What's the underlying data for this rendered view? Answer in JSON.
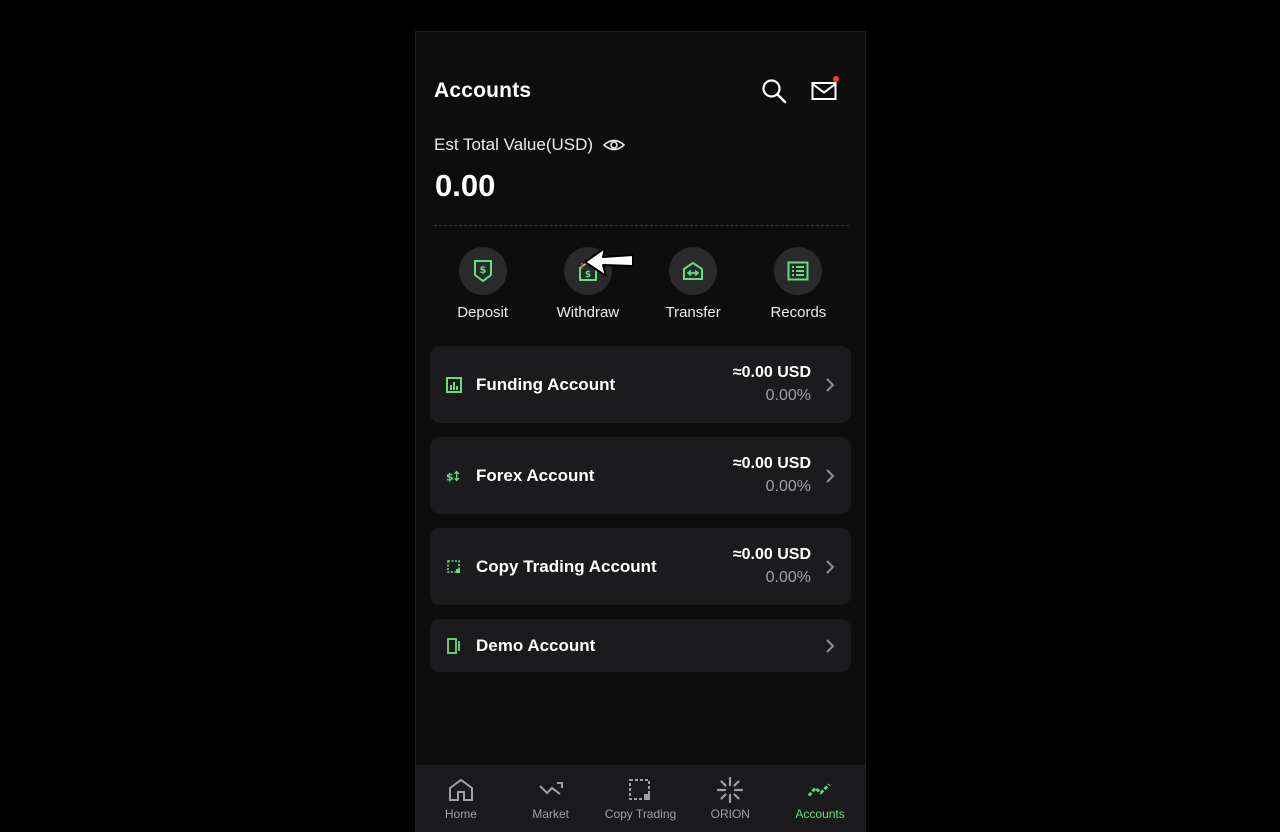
{
  "header": {
    "title": "Accounts",
    "search_icon": "search-icon",
    "mail_icon": "mail-icon",
    "has_notification": true
  },
  "summary": {
    "est_label": "Est Total Value(USD)",
    "eye_icon": "eye-icon",
    "total_value": "0.00"
  },
  "actions": [
    {
      "label": "Deposit",
      "icon": "deposit-icon"
    },
    {
      "label": "Withdraw",
      "icon": "withdraw-icon"
    },
    {
      "label": "Transfer",
      "icon": "transfer-icon"
    },
    {
      "label": "Records",
      "icon": "records-icon"
    }
  ],
  "accounts": [
    {
      "name": "Funding Account",
      "usd": "≈0.00 USD",
      "pct": "0.00%",
      "icon": "funding-icon"
    },
    {
      "name": "Forex Account",
      "usd": "≈0.00 USD",
      "pct": "0.00%",
      "icon": "forex-icon"
    },
    {
      "name": "Copy Trading Account",
      "usd": "≈0.00 USD",
      "pct": "0.00%",
      "icon": "copy-trading-icon"
    },
    {
      "name": "Demo Account",
      "icon": "demo-icon"
    }
  ],
  "tabbar": [
    {
      "label": "Home",
      "icon": "home-icon",
      "active": false
    },
    {
      "label": "Market",
      "icon": "market-icon",
      "active": false
    },
    {
      "label": "Copy Trading",
      "icon": "copy-trading-tab-icon",
      "active": false
    },
    {
      "label": "ORION",
      "icon": "orion-icon",
      "active": false
    },
    {
      "label": "Accounts",
      "icon": "accounts-icon",
      "active": true
    }
  ],
  "colors": {
    "background": "#0d0d0e",
    "card": "#1b1b1e",
    "accent": "#5fe07a",
    "notification": "#ff3b30",
    "muted": "#a0a0a5"
  }
}
